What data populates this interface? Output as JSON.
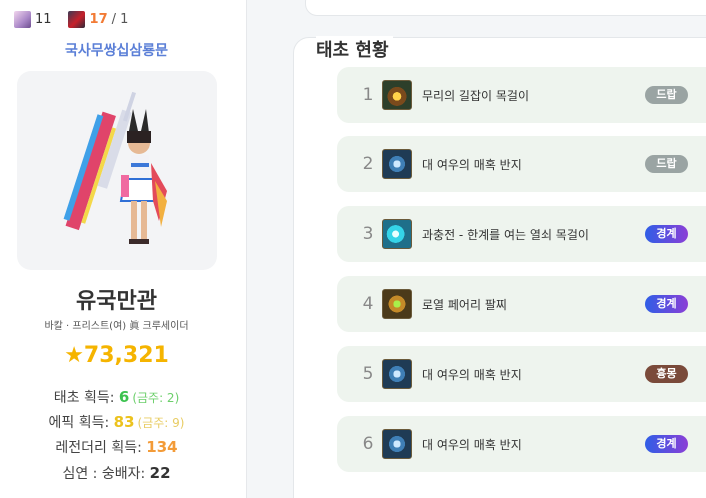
{
  "profile": {
    "char_icon_count": "11",
    "red_icon_count": "17",
    "red_icon_total": "/ 1",
    "guild": "국사무쌍십삼룡문",
    "name": "유국만관",
    "subtitle": "바칼 · 프리스트(여) 眞 크루세이더",
    "fame": "★73,321",
    "stats": {
      "taecho_label": "태초 획득: ",
      "taecho_value": "6",
      "taecho_sub": "(금주: 2)",
      "epic_label": "에픽 획득: ",
      "epic_value": "83",
      "epic_sub": "(금주: 9)",
      "legendary_label": "레전더리 획득: ",
      "legendary_value": "134",
      "abyss_label": "심연 : 숭배자: ",
      "abyss_value": "22"
    }
  },
  "panel": {
    "title": "태초 현황",
    "items": [
      {
        "rank": "1",
        "name": "무리의 길잡이 목걸이",
        "badge": "드랍",
        "icon": "necklace-icon"
      },
      {
        "rank": "2",
        "name": "대 여우의 매혹 반지",
        "badge": "드랍",
        "icon": "ring-icon"
      },
      {
        "rank": "3",
        "name": "과충전 - 한계를 여는 열쇠 목걸이",
        "badge": "경계",
        "icon": "necklace-icon"
      },
      {
        "rank": "4",
        "name": "로열 페어리 팔찌",
        "badge": "경계",
        "icon": "bracelet-icon"
      },
      {
        "rank": "5",
        "name": "대 여우의 매혹 반지",
        "badge": "흉몽",
        "icon": "ring-icon"
      },
      {
        "rank": "6",
        "name": "대 여우의 매혹 반지",
        "badge": "경계",
        "icon": "ring-icon"
      }
    ]
  },
  "colors": {
    "guild": "#5b7fd7",
    "fame": "#f5b400",
    "taecho": "#3cc24f",
    "epic": "#ecc21d",
    "legendary": "#f39b38",
    "badge_drop": "#9aa4a3",
    "badge_border": "#2f5ee6",
    "badge_nightmare": "#7a4a3a"
  }
}
